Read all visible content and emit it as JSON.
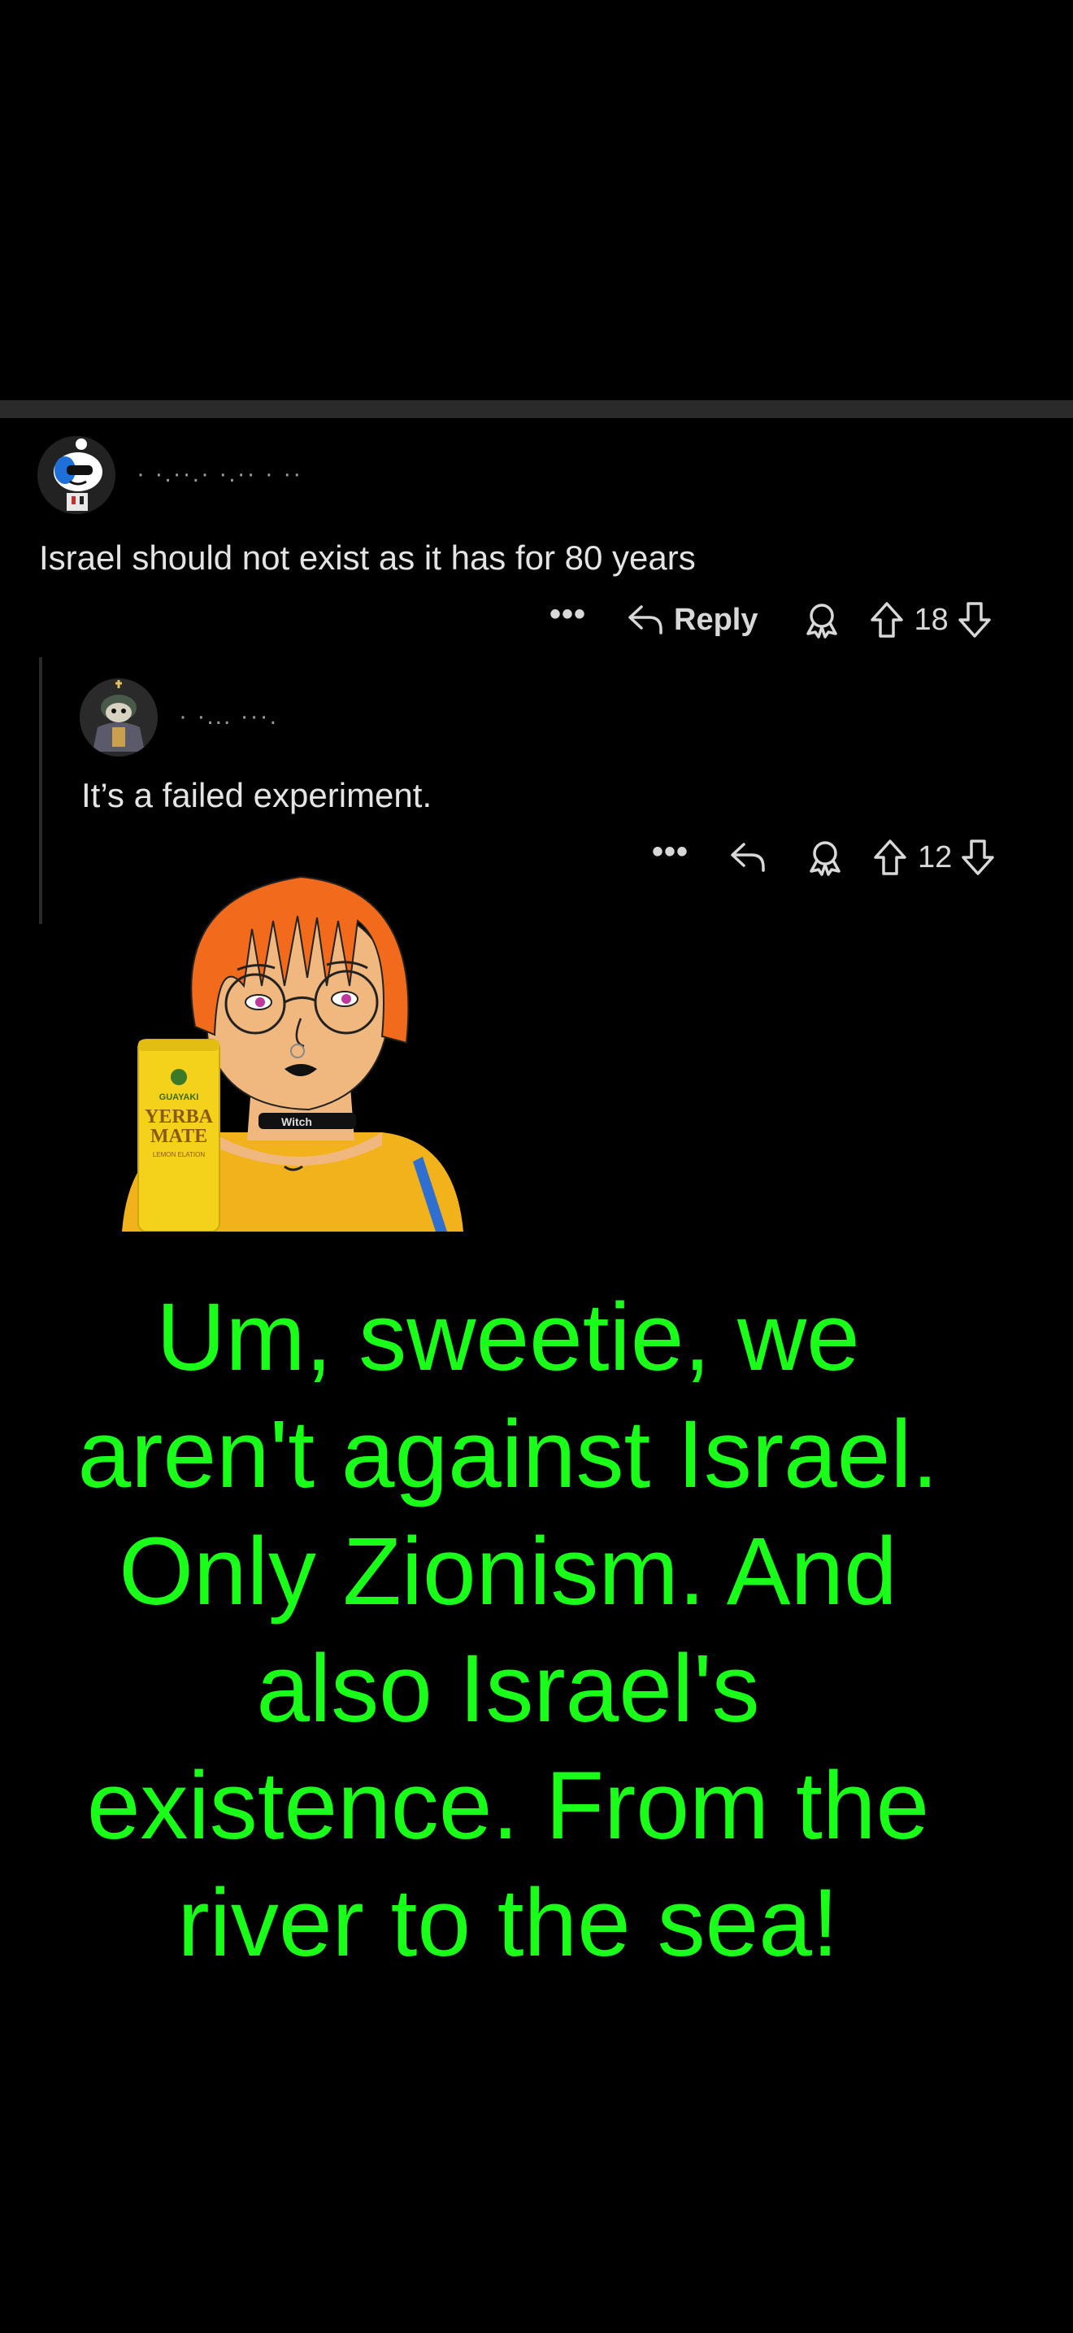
{
  "colors": {
    "background": "#000000",
    "text": "#e4e4e4",
    "muted": "#9a9a9a",
    "meme_text": "#1aff1a",
    "divider": "#2a2a2a"
  },
  "comments": [
    {
      "meta": "· ·.··.·       ·.·· · ··",
      "text": "Israel should not exist as it has for 80 years",
      "actions": {
        "more_icon": "more-dots-icon",
        "reply_label": "Reply",
        "award_icon": "award-icon",
        "upvote_icon": "upvote-arrow-icon",
        "score": "18",
        "downvote_icon": "downvote-arrow-icon"
      }
    },
    {
      "meta": "· ·...            ···.",
      "text": "It’s a failed experiment.",
      "actions": {
        "more_icon": "more-dots-icon",
        "reply_icon": "reply-arrow-icon",
        "award_icon": "award-icon",
        "upvote_icon": "upvote-arrow-icon",
        "score": "12",
        "downvote_icon": "downvote-arrow-icon"
      }
    }
  ],
  "meme": {
    "can_label_top": "GUAYAKI",
    "can_label_main_1": "YERBA",
    "can_label_main_2": "MATE",
    "can_label_small": "LEMON ELATION",
    "choker_text": "Witch",
    "caption": "Um, sweetie, we aren't against Israel. Only Zionism. And also Israel's existence. From the river to the sea!"
  }
}
